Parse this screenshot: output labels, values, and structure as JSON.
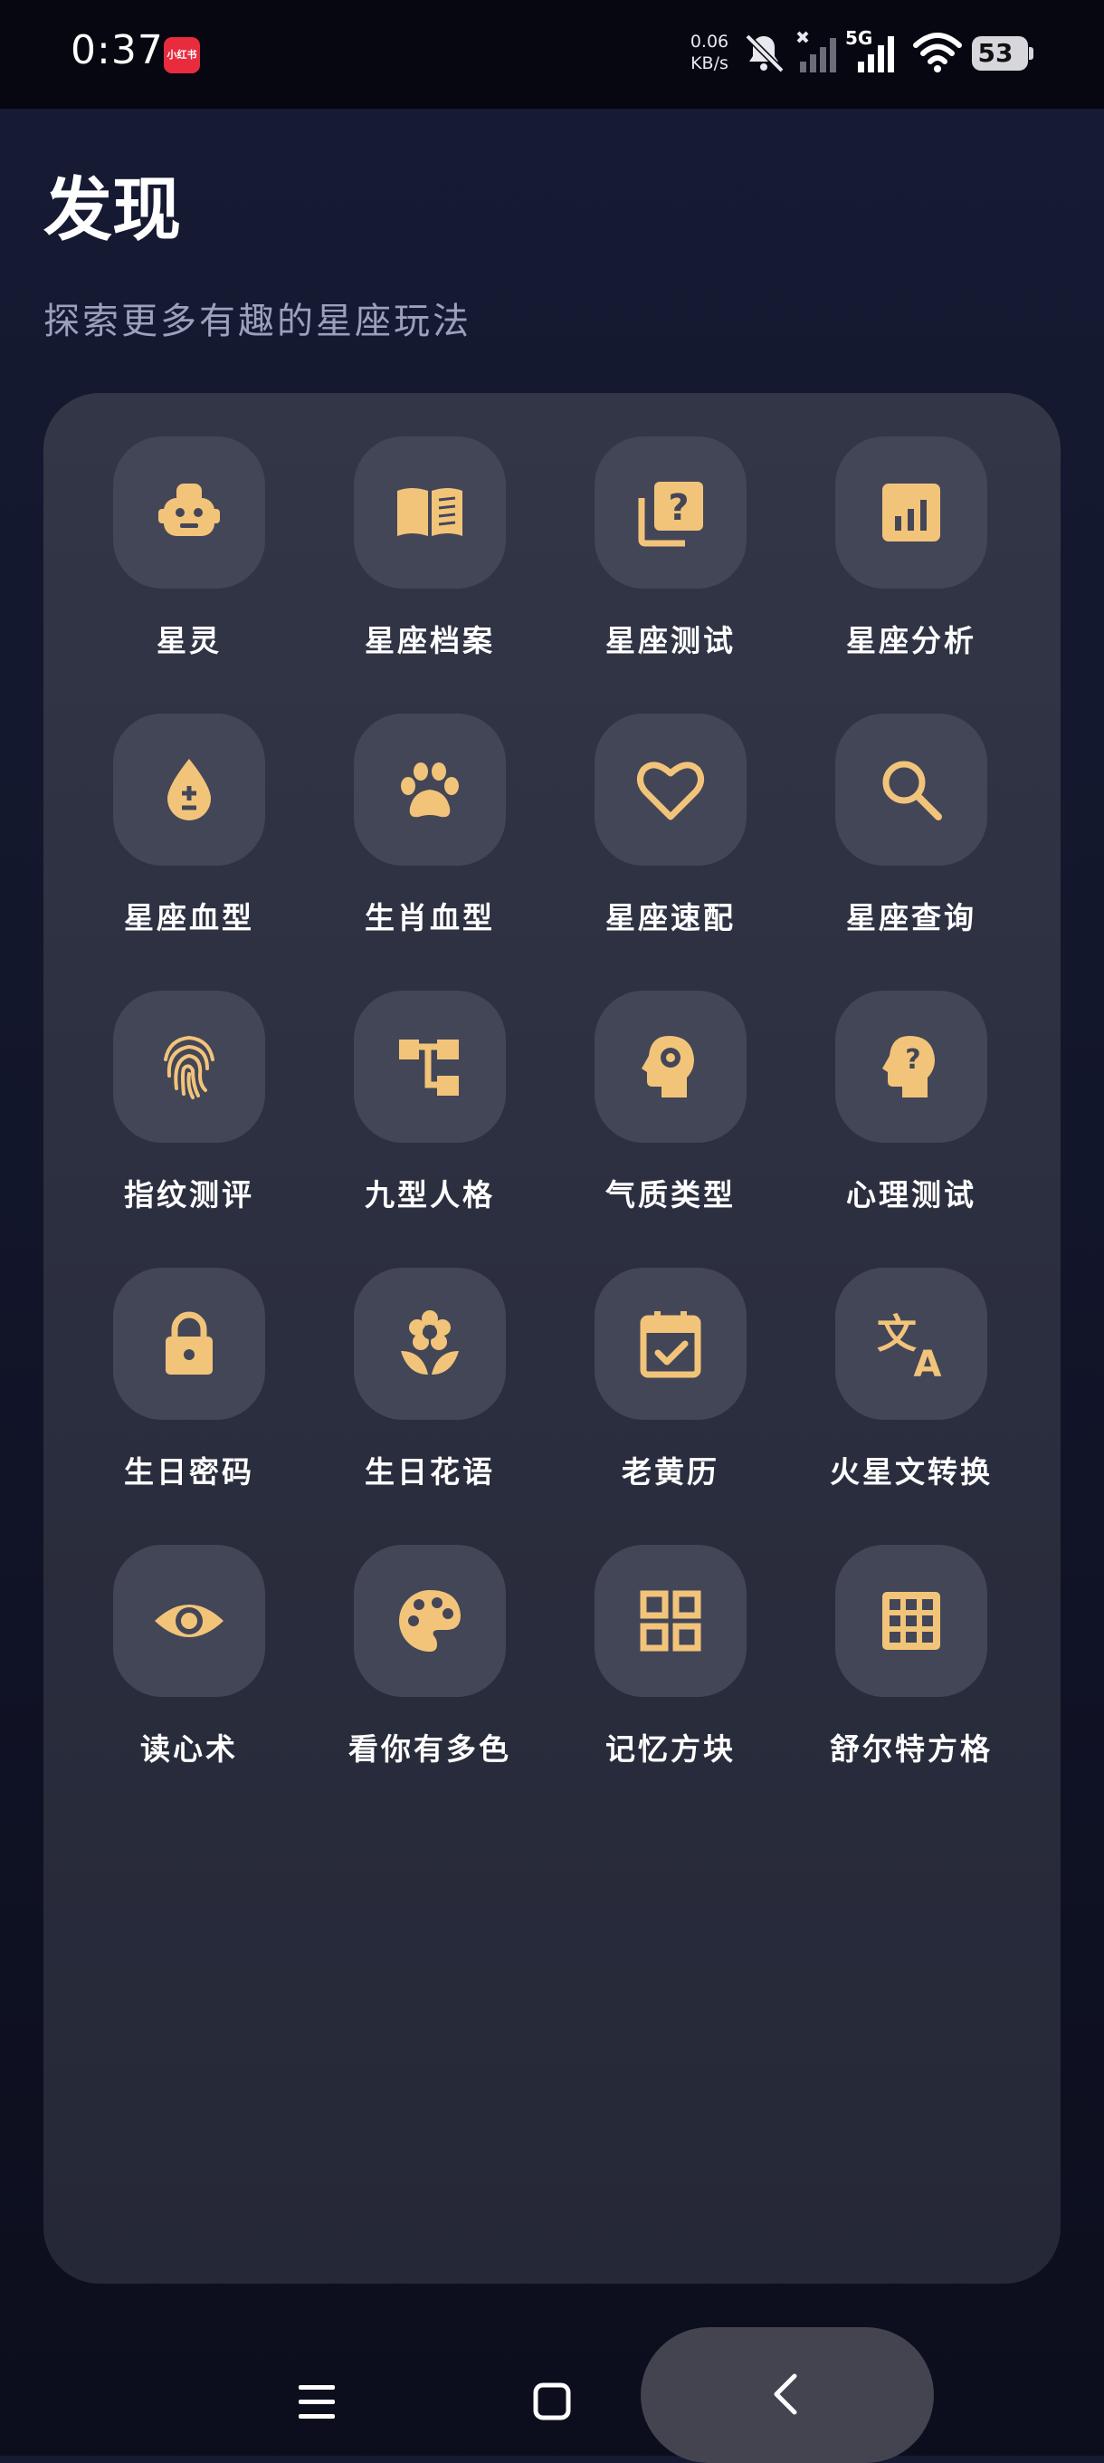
{
  "status_bar": {
    "time": "0:37",
    "app_badge": "小红书",
    "net_speed_value": "0.06",
    "net_speed_unit": "KB/s",
    "network": "5G",
    "battery": "53"
  },
  "header": {
    "title": "发现",
    "subtitle": "探索更多有趣的星座玩法"
  },
  "colors": {
    "accent": "#f2c47a",
    "tile_bg": "#434657",
    "card_bg": "#2e3142"
  },
  "tiles": [
    {
      "label": "星灵",
      "icon": "robot-icon"
    },
    {
      "label": "星座档案",
      "icon": "book-icon"
    },
    {
      "label": "星座测试",
      "icon": "quiz-icon"
    },
    {
      "label": "星座分析",
      "icon": "analytics-icon"
    },
    {
      "label": "星座血型",
      "icon": "blood-drop-icon"
    },
    {
      "label": "生肖血型",
      "icon": "paw-icon"
    },
    {
      "label": "星座速配",
      "icon": "heart-icon"
    },
    {
      "label": "星座查询",
      "icon": "search-icon"
    },
    {
      "label": "指纹测评",
      "icon": "fingerprint-icon"
    },
    {
      "label": "九型人格",
      "icon": "hierarchy-icon"
    },
    {
      "label": "气质类型",
      "icon": "head-gear-icon"
    },
    {
      "label": "心理测试",
      "icon": "head-question-icon"
    },
    {
      "label": "生日密码",
      "icon": "lock-icon"
    },
    {
      "label": "生日花语",
      "icon": "flower-icon"
    },
    {
      "label": "老黄历",
      "icon": "calendar-check-icon"
    },
    {
      "label": "火星文转换",
      "icon": "translate-icon"
    },
    {
      "label": "读心术",
      "icon": "eye-icon"
    },
    {
      "label": "看你有多色",
      "icon": "palette-icon"
    },
    {
      "label": "记忆方块",
      "icon": "grid-icon"
    },
    {
      "label": "舒尔特方格",
      "icon": "table-grid-icon"
    }
  ],
  "nav": {
    "menu_icon": "menu-icon",
    "home_icon": "home-square-icon",
    "back_icon": "back-chevron-icon"
  }
}
